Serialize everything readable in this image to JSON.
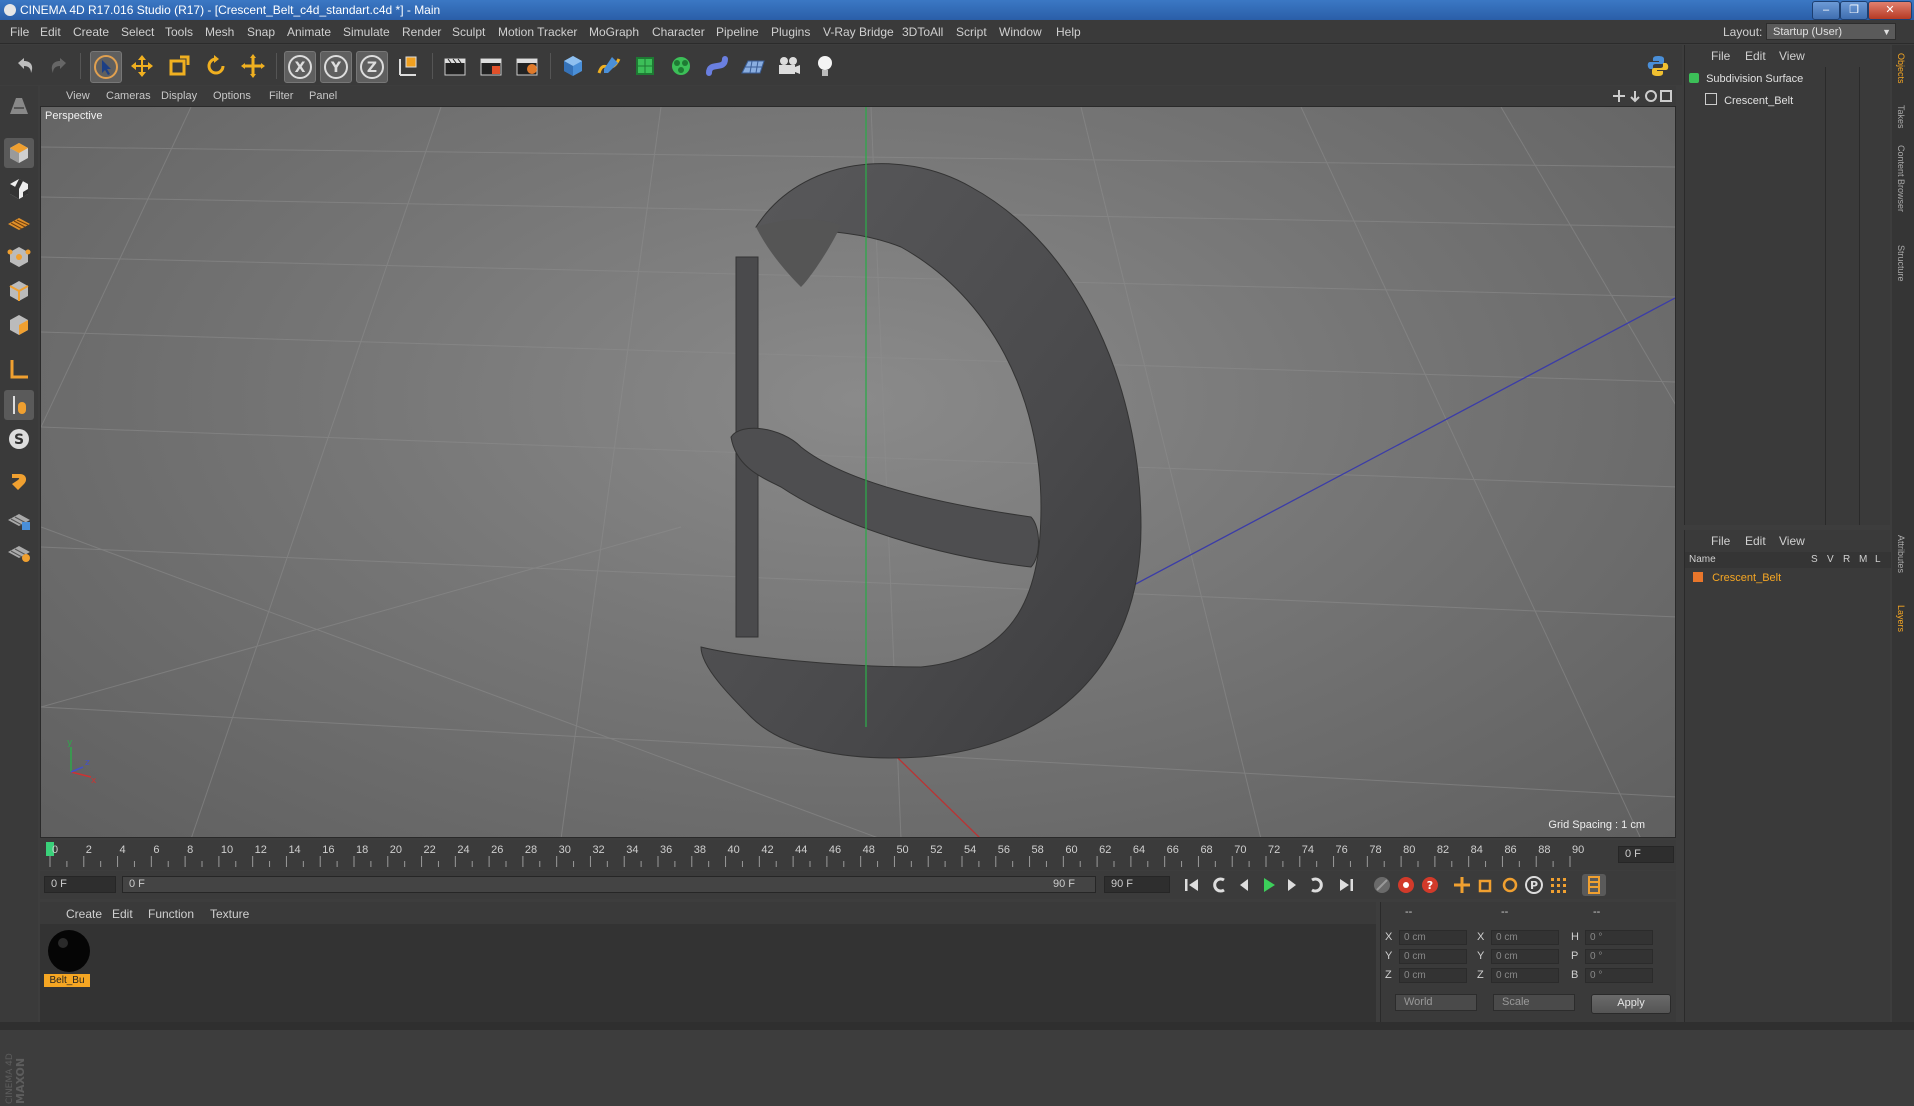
{
  "window": {
    "title": "CINEMA 4D R17.016 Studio (R17) - [Crescent_Belt_c4d_standart.c4d *] - Main",
    "minimize": "‒",
    "maximize": "❐",
    "close": "✕"
  },
  "menu": {
    "items": [
      "File",
      "Edit",
      "Create",
      "Select",
      "Tools",
      "Mesh",
      "Snap",
      "Animate",
      "Simulate",
      "Render",
      "Sculpt",
      "Motion Tracker",
      "MoGraph",
      "Character",
      "Pipeline",
      "Plugins",
      "V-Ray Bridge",
      "3DToAll",
      "Script",
      "Window",
      "Help"
    ],
    "layout_label": "Layout:",
    "layout_value": "Startup (User)"
  },
  "toolbar": {
    "icons": [
      "undo-icon",
      "redo-icon",
      "select-arrow-icon",
      "move-icon",
      "scale-icon",
      "rotate-icon",
      "live-select-icon",
      "x-axis-icon",
      "y-axis-icon",
      "z-axis-icon",
      "coordinate-system-icon",
      "render-view-icon",
      "render-picture-viewer-icon",
      "edit-render-settings-icon",
      "cube-icon",
      "pen-spline-icon",
      "subdivision-icon",
      "cloner-icon",
      "deformer-icon",
      "floor-icon",
      "camera-icon",
      "light-icon",
      "python-icon"
    ],
    "axis_labels": [
      "X",
      "Y",
      "Z"
    ]
  },
  "left_tools": [
    "make-editable-icon",
    "model-mode-icon",
    "texture-mode-icon",
    "workplane-icon",
    "points-mode-icon",
    "edges-mode-icon",
    "polygons-mode-icon",
    "axis-mode-icon",
    "tweak-mode-icon",
    "solo-icon",
    "snap-icon",
    "locked-workplane-icon",
    "planar-workplane-icon"
  ],
  "viewport": {
    "menu": [
      "View",
      "Cameras",
      "Display",
      "Options",
      "Filter",
      "Panel"
    ],
    "label": "Perspective",
    "grid_spacing": "Grid Spacing : 1 cm",
    "axis_y": "y",
    "axis_x": "x",
    "axis_z": "z"
  },
  "timeline": {
    "ticks": [
      "0",
      "2",
      "4",
      "6",
      "8",
      "10",
      "12",
      "14",
      "16",
      "18",
      "20",
      "22",
      "24",
      "26",
      "28",
      "30",
      "32",
      "34",
      "36",
      "38",
      "40",
      "42",
      "44",
      "46",
      "48",
      "50",
      "52",
      "54",
      "56",
      "58",
      "60",
      "62",
      "64",
      "66",
      "68",
      "70",
      "72",
      "74",
      "76",
      "78",
      "80",
      "82",
      "84",
      "86",
      "88",
      "90"
    ],
    "current": "0 F",
    "start_field": "0 F",
    "range_start": "0 F",
    "range_end": "90 F",
    "end_field": "90 F"
  },
  "materials": {
    "menu": [
      "Create",
      "Edit",
      "Function",
      "Texture"
    ],
    "items": [
      {
        "name": "Belt_Bu"
      }
    ]
  },
  "coordinates": {
    "header": [
      "--",
      "--",
      "--"
    ],
    "rows": [
      {
        "axis": "X",
        "pos": "0 cm",
        "size_axis": "X",
        "size": "0 cm",
        "rot_axis": "H",
        "rot": "0 °"
      },
      {
        "axis": "Y",
        "pos": "0 cm",
        "size_axis": "Y",
        "size": "0 cm",
        "rot_axis": "P",
        "rot": "0 °"
      },
      {
        "axis": "Z",
        "pos": "0 cm",
        "size_axis": "Z",
        "size": "0 cm",
        "rot_axis": "B",
        "rot": "0 °"
      }
    ],
    "mode": "World",
    "mode2": "Scale",
    "apply": "Apply"
  },
  "objects": {
    "menu": [
      "File",
      "Edit",
      "View"
    ],
    "tree": [
      {
        "name": "Subdivision Surface"
      },
      {
        "name": "Crescent_Belt"
      }
    ]
  },
  "layers": {
    "menu": [
      "File",
      "Edit",
      "View"
    ],
    "columns": [
      "Name",
      "S",
      "V",
      "R",
      "M",
      "L"
    ],
    "items": [
      {
        "name": "Crescent_Belt",
        "color": "#e8762b"
      }
    ]
  },
  "right_tabs": [
    "Objects",
    "Takes",
    "Content Browser",
    "Structure",
    "Attributes",
    "Layers"
  ],
  "colors": {
    "accent": "#f5a623",
    "timeline_marker": "#3ad17a",
    "green_axis": "#2ea84a"
  }
}
